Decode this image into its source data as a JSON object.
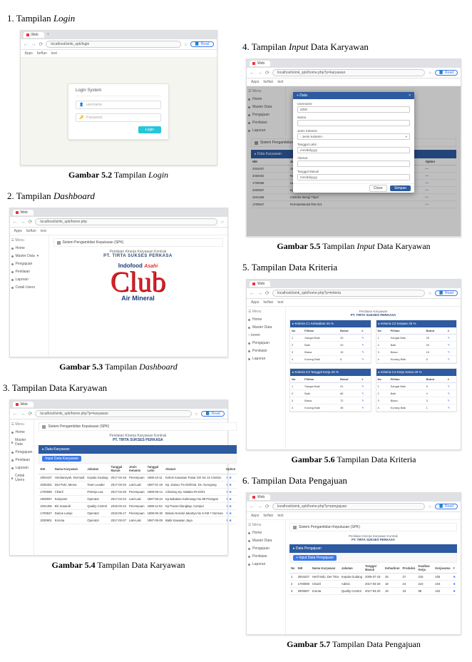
{
  "sec1_title_pre": "1.  Tampilan ",
  "sec1_title_it": "Login",
  "sec2_title_pre": "2.    Tampilan ",
  "sec2_title_it": "Dashboard",
  "sec3_title": "3.    Tampilan Data Karyawan",
  "sec4_title_pre": "4.    Tampilan ",
  "sec4_title_it": "Input",
  "sec4_title_post": " Data Karyawan",
  "sec5_title": "5.  Tampilan Data Kriteria",
  "sec6_title": "6.  Tampilan Data Pengajuan",
  "cap52_b": "Gambar 5.2",
  "cap52_txt": " Tampilan ",
  "cap52_it": "Login",
  "cap53_b": "Gambar 5.3",
  "cap53_txt": " Tampilan ",
  "cap53_it": "Dashboard",
  "cap54_b": "Gambar 5.4",
  "cap54_txt": " Tampilan Data Karyawan",
  "cap55_b": "Gambar 5.5",
  "cap55_txt": " Tampilan ",
  "cap55_it": "Input",
  "cap55_post": " Data Karyawan",
  "cap56_b": "Gambar 5.6",
  "cap56_txt": " Tampilan Data Kriteria",
  "cap57_b": "Gambar 5.7",
  "cap57_txt": " Tampilan Data Pengajuan",
  "browser": {
    "tab_label": "Web",
    "bookmarks": [
      "Apps",
      "farflan",
      "test"
    ],
    "url_login": "localhost/simk_spk/login",
    "url_dash": "localhost/simk_spk/home.php",
    "url_kary": "localhost/simk_spk/home.php?p=karyawan",
    "url_input": "localhost/simk_spk/home.php?p=karyawan",
    "url_krit": "localhost/simk_spk/home.php?p=kriteria",
    "url_peng": "localhost/simk_spk/home.php?p=pengajuan",
    "read": "Read"
  },
  "login": {
    "card_title": "Login System",
    "user_ph": "username",
    "pass_ph": "Password",
    "btn": "Login"
  },
  "sidebar": {
    "menu": "☰ Menu",
    "items": [
      "Home",
      "Master Data",
      "Pengajuan",
      "Penilaian",
      "Laporan",
      "Cetak Users"
    ]
  },
  "dash": {
    "panel": "Sistem Pengambilan Keputusan (SPK)",
    "line1": "Penilaian Kinerja Karyawan Kontrak",
    "line2": "PT. TIRTA SUKSES PERKASA",
    "logo1a": "Indofood",
    "logo1b": "Asahi",
    "logo2": "Club",
    "logo3": "Air Mineral"
  },
  "kary": {
    "blue": "▸ Data Karyawan",
    "add": "Input Data Karyawan",
    "head": [
      "NIK",
      "Nama Karyawan",
      "Jabatan",
      "Tanggal Masuk",
      "Jenis Kelamin",
      "Tanggal Lahir",
      "Alamat",
      "Option"
    ],
    "rows": [
      [
        "2004437",
        "Herdiansyah, Dermadi",
        "Kepala Gudang",
        "2017-04-18",
        "Perempuan",
        "1986-10-11",
        "Kebon Kawasan Pasar Giri No 13 Cirebon",
        "✎ ✖"
      ],
      [
        "2030402",
        "Dwi Putri, Mema",
        "Team Leader",
        "2017-03-20",
        "Laki-Laki",
        "1987-01-19",
        "Kp. Danau Tm 003/043, Ds. Gerogong",
        "✎ ✖"
      ],
      [
        "1700069",
        "Chairil",
        "Pekerja Las",
        "2017-04-26",
        "Perempuan",
        "1989-08-14",
        "Cilodong Kp. Malaka Rt 02/01",
        "✎ ✖"
      ],
      [
        "2000597",
        "Kariyanto",
        "Operator",
        "2017-04-24",
        "Laki-Laki",
        "1987-06-24",
        "Kp Babakan Kalimangu No 88 Priangan",
        "✎ ✖"
      ],
      [
        "2031455",
        "Eki Susandi",
        "Quality Control",
        "2016-03-10",
        "Perempuan",
        "1988-11-04",
        "Kp Pusat Cilangkap, Campur",
        "✎ ✖"
      ],
      [
        "1700847",
        "Darius Lampi",
        "Operator",
        "2018-05-17",
        "Perempuan",
        "1996-05-30",
        "Bekasi Kendal Jakartya No 5 KM 7 Norman",
        "✎ ✖"
      ],
      [
        "2030901",
        "Korona",
        "Operator",
        "2017-03-07",
        "Laki-Laki",
        "1987-05-09",
        "Batik Kawasan Jaya",
        "✎ ✖"
      ]
    ]
  },
  "modal": {
    "title": "+ Data",
    "f_user_l": "Username",
    "f_user_v": "2000",
    "f_nama_l": "Nama",
    "f_jk_l": "Jenis Kelamin",
    "f_jk_ph": "- Jenis Kelamin -",
    "f_tgl_l": "Tanggal Lahir",
    "f_tgl_ph": "mm/dd/yyyy",
    "f_al_l": "Alamat",
    "f_tg_l": "Tanggal Masuk",
    "f_tg_ph": "mm/dd/yyyy",
    "close": "Close",
    "save": "Simpan"
  },
  "modal_bg": {
    "blue": "▸ Data Karyawan",
    "head": [
      "NIK",
      "Jabatan",
      "Option"
    ],
    "rows": [
      [
        "2004437",
        "Jnda Bojonggede Bulak 003 Cionang",
        "• •"
      ],
      [
        "2030402",
        "Recta LaMANDA, Ketar Bioteng",
        "• •"
      ],
      [
        "1700069",
        "Larantuen Nongadeg b",
        "• •"
      ],
      [
        "2000597",
        "Kp Babakan Cire NO/073 Cianur",
        "• •"
      ],
      [
        "2031455",
        "Cistrobe Wengi Tripel",
        "• •"
      ],
      [
        "1700847",
        "PermanMandul RW 013",
        "• •"
      ]
    ]
  },
  "krit": {
    "title1": "Penilaian Karyawan",
    "title2": "PT. TIRTA SUKSES PERKASA",
    "item1": "▸ Kriteria C1 Kehadiran 25 %",
    "item2": "▸ Kriteria C2 Kerjaan 25 %",
    "item3": "▸ Kriteria C3 Tanggal Kerja 25 %",
    "item4": "▸ Kriteria C4 Kerja Sama 25 %",
    "plus": "+",
    "thead": [
      "No",
      "Pilihan",
      "Bobot",
      "#"
    ],
    "r1": [
      [
        "1",
        "Sangat Baik",
        "25",
        "✎"
      ],
      [
        "2",
        "Baik",
        "20",
        "✎"
      ],
      [
        "3",
        "Biasa",
        "15",
        "✎"
      ],
      [
        "4",
        "Kurang Baik",
        "5",
        "✎"
      ]
    ],
    "r2": [
      [
        "1",
        "Sangat Baik",
        "25",
        "✎"
      ],
      [
        "2",
        "Baik",
        "20",
        "✎"
      ],
      [
        "3",
        "Biasa",
        "15",
        "✎"
      ],
      [
        "4",
        "Kurang Baik",
        "5",
        "✎"
      ]
    ],
    "r3": [
      [
        "1",
        "Sangat Baik",
        "91",
        "✎"
      ],
      [
        "2",
        "Baik",
        "86",
        "✎"
      ],
      [
        "3",
        "Biasa",
        "72",
        "✎"
      ],
      [
        "4",
        "Kurang Baik",
        "35",
        "✎"
      ]
    ],
    "r4": [
      [
        "1",
        "Sangat Baik",
        "5",
        "✎"
      ],
      [
        "2",
        "Baik",
        "4",
        " ✎"
      ],
      [
        "3",
        "Biasa",
        "3",
        "✎"
      ],
      [
        "4",
        "Kurang Baik",
        "1",
        "✎"
      ]
    ]
  },
  "peng": {
    "blue": "▸ Data Pengajuan",
    "add": "+ Input Data Pengajuan",
    "head": [
      "No",
      "NIK",
      "Nama Karyawan",
      "Jabatan",
      "Tanggal Masuk",
      "Kehadiran",
      "Produksi",
      "Kualitas Kerja",
      "Kerjasama",
      "#"
    ],
    "rows": [
      [
        "1",
        "2004437",
        "Herli’mido, Der Tirta",
        "Kepala Gudang",
        "2005-07-18",
        "25",
        "27",
        "216",
        "105",
        "✖"
      ],
      [
        "2",
        "1700069",
        "Chairil",
        "Admin",
        "2017-03-20",
        "18",
        "24",
        "210",
        "104",
        "✖"
      ],
      [
        "3",
        "2000597",
        "Koruta",
        "Quality Control",
        "2017-03-20",
        "19",
        "23",
        "98",
        "102",
        "✖"
      ]
    ]
  },
  "lorem": "– lorem"
}
